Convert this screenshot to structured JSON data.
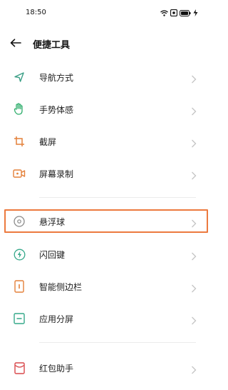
{
  "status_bar": {
    "time": "18:50",
    "icons": [
      "wifi-icon",
      "signal-icon",
      "battery-icon",
      "charging-icon"
    ]
  },
  "header": {
    "back_icon": "arrow-left-icon",
    "title": "便捷工具"
  },
  "items": [
    {
      "label": "导航方式",
      "icon": "navigation-icon",
      "color": "#3a9f86"
    },
    {
      "label": "手势体感",
      "icon": "gesture-hand-icon",
      "color": "#2fae6c"
    },
    {
      "label": "截屏",
      "icon": "screenshot-crop-icon",
      "color": "#e4803a"
    },
    {
      "label": "屏幕录制",
      "icon": "screen-record-icon",
      "color": "#e4803a"
    },
    {
      "label": "悬浮球",
      "icon": "floating-ball-icon",
      "color": "#8a8a8a",
      "highlighted": true
    },
    {
      "label": "闪回键",
      "icon": "flashback-icon",
      "color": "#35a88a"
    },
    {
      "label": "智能侧边栏",
      "icon": "smart-sidebar-icon",
      "color": "#e4803a"
    },
    {
      "label": "应用分屏",
      "icon": "split-screen-icon",
      "color": "#35a88a"
    },
    {
      "label": "红包助手",
      "icon": "red-envelope-icon",
      "color": "#d9484b"
    }
  ],
  "colors": {
    "highlight_border": "#ec7a3f",
    "chevron": "#c4c4c4",
    "divider": "#ececec"
  }
}
